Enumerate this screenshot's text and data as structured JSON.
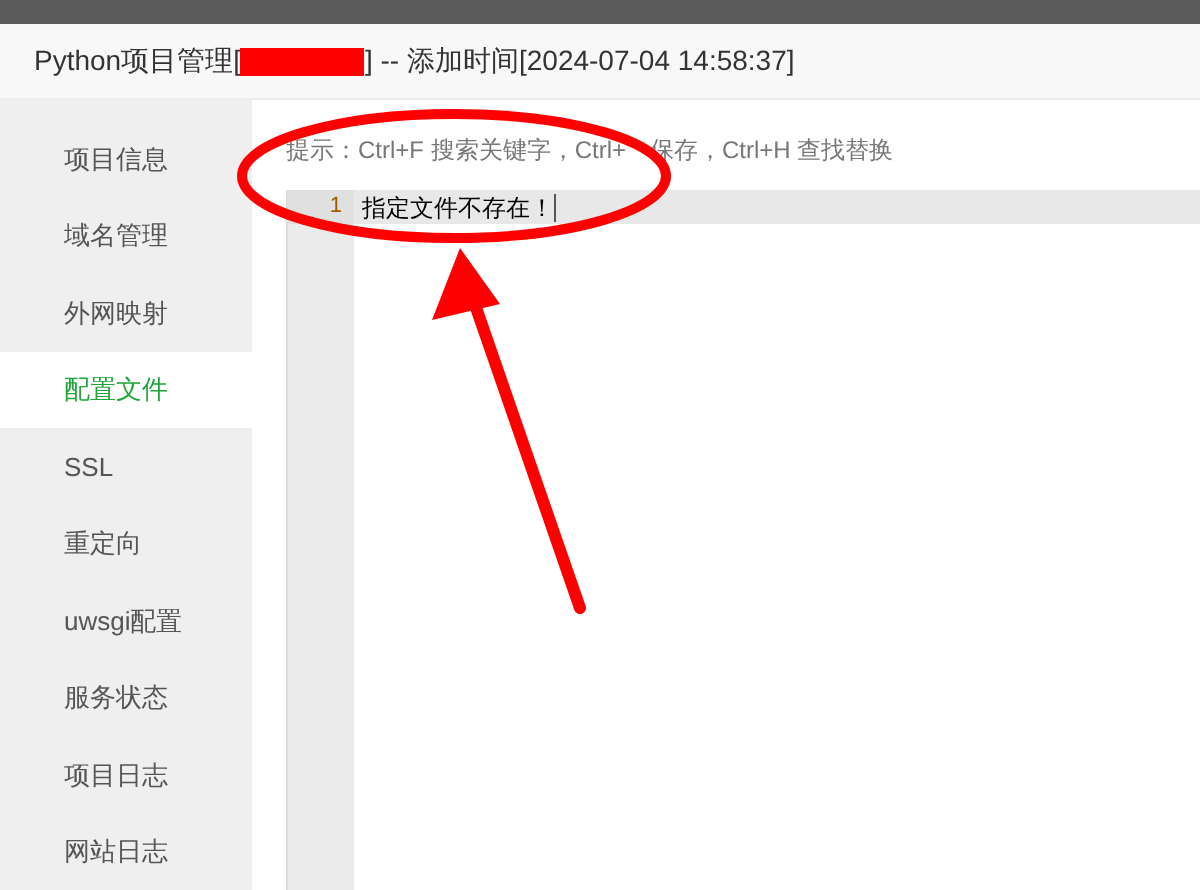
{
  "window": {
    "title_prefix": "Python项目管理[",
    "title_redacted": true,
    "title_suffix": "] -- 添加时间[2024-07-04 14:58:37]"
  },
  "sidebar": {
    "items": [
      {
        "label": "项目信息",
        "selected": false
      },
      {
        "label": "域名管理",
        "selected": false
      },
      {
        "label": "外网映射",
        "selected": false
      },
      {
        "label": "配置文件",
        "selected": true
      },
      {
        "label": "SSL",
        "selected": false
      },
      {
        "label": "重定向",
        "selected": false
      },
      {
        "label": "uwsgi配置",
        "selected": false
      },
      {
        "label": "服务状态",
        "selected": false
      },
      {
        "label": "项目日志",
        "selected": false
      },
      {
        "label": "网站日志",
        "selected": false
      }
    ]
  },
  "hint": [
    "提示：Ctrl+F 搜索关键字，Ctrl+",
    "保存，Ctrl+H 查找替换"
  ],
  "editor": {
    "lines": [
      {
        "number": "1",
        "text": "指定文件不存在！",
        "active": true
      }
    ]
  },
  "annotations": {
    "circle": true,
    "arrow": true
  }
}
